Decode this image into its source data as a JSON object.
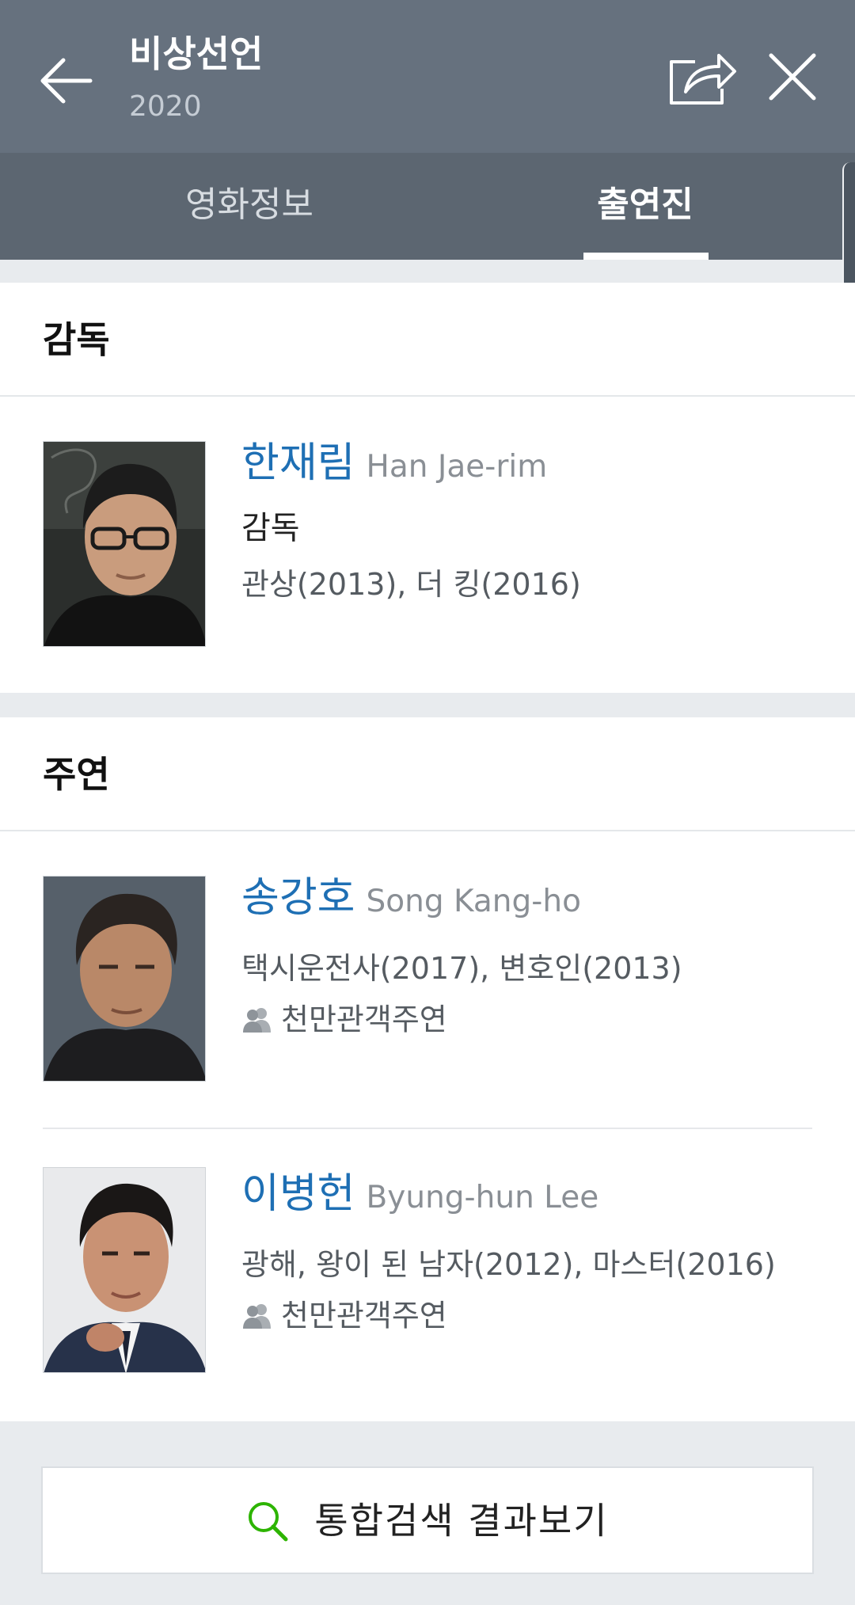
{
  "header": {
    "title": "비상선언",
    "year": "2020"
  },
  "tabs": [
    {
      "label": "영화정보",
      "active": false
    },
    {
      "label": "출연진",
      "active": true
    }
  ],
  "sections": {
    "director": {
      "heading": "감독",
      "people": [
        {
          "name_ko": "한재림",
          "name_en": "Han Jae-rim",
          "role": "감독",
          "works": "관상(2013), 더 킹(2016)"
        }
      ]
    },
    "lead": {
      "heading": "주연",
      "people": [
        {
          "name_ko": "송강호",
          "name_en": "Song Kang-ho",
          "works": "택시운전사(2017), 변호인(2013)",
          "badge": "천만관객주연"
        },
        {
          "name_ko": "이병헌",
          "name_en": "Byung-hun Lee",
          "works": "광해, 왕이 된 남자(2012), 마스터(2016)",
          "badge": "천만관객주연"
        }
      ]
    }
  },
  "footer": {
    "search_label": "통합검색 결과보기"
  },
  "icons": {
    "back": "arrow-left-icon",
    "share": "share-icon",
    "close": "close-icon",
    "badge": "people-icon",
    "search": "search-icon"
  },
  "colors": {
    "header_bg": "#66717e",
    "tab_bg": "#5c6671",
    "name_link": "#1e6fb4",
    "search_icon": "#2db400"
  }
}
